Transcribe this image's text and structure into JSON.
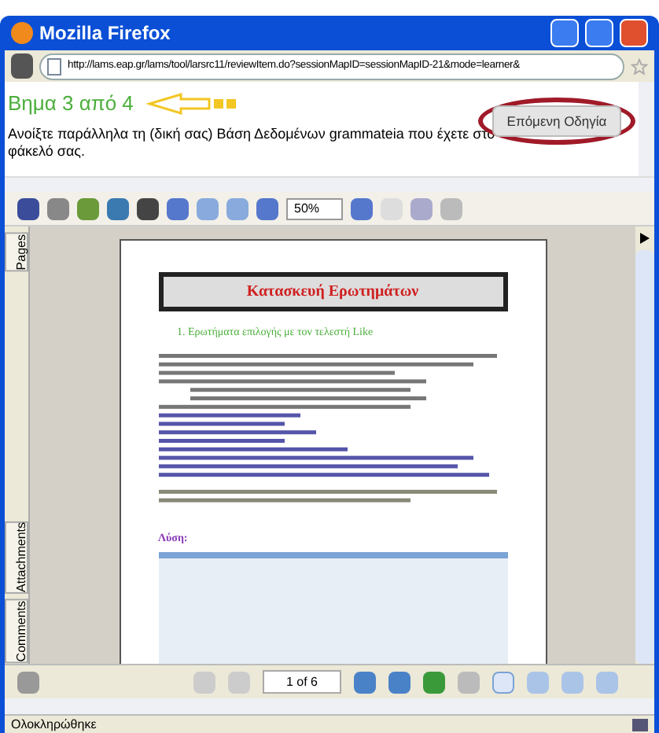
{
  "window": {
    "title": "Mozilla Firefox"
  },
  "address_bar": {
    "url": "http://lams.eap.gr/lams/tool/larsrc11/reviewItem.do?sessionMapID=sessionMapID-21&mode=learner&"
  },
  "lesson": {
    "step": "Βημα 3 από 4",
    "instruction": "Ανοίξτε παράλληλα τη (δική σας) Βάση Δεδομένων grammateia που έχετε στο φάκελό σας.",
    "next_button": "Επόμενη Οδηγία"
  },
  "pdf_toolbar": {
    "zoom": "50%"
  },
  "side_tabs": [
    {
      "label": "Pages",
      "selected": false
    },
    {
      "label": "Attachments",
      "selected": false
    },
    {
      "label": "Comments",
      "selected": false
    }
  ],
  "document": {
    "title": "Κατασκευή Ερωτημάτων",
    "heading": "1.   Ερωτήματα επιλογής με τον τελεστή Like",
    "solution_label": "Λύση:"
  },
  "page_nav": {
    "page": "1 of 6"
  },
  "status_bar": {
    "text": "Ολοκληρώθηκε"
  }
}
